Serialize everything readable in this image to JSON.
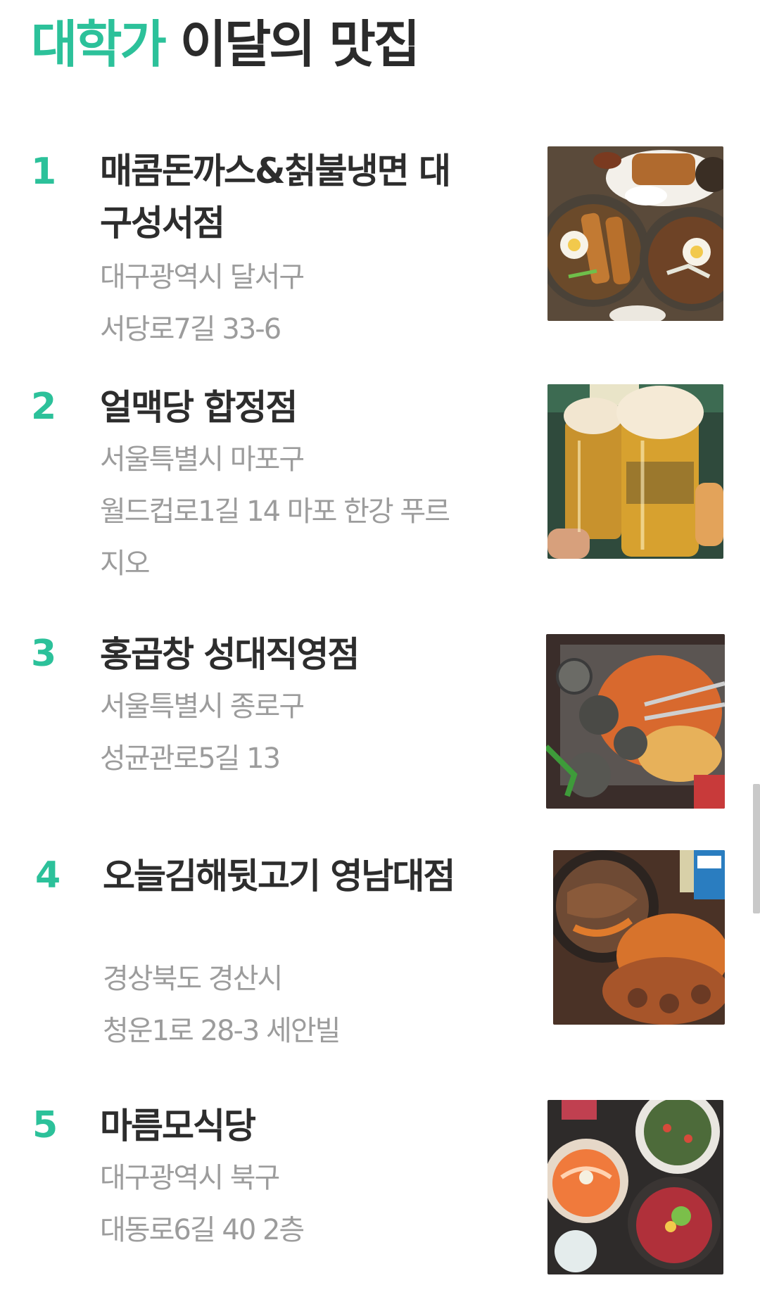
{
  "header": {
    "title_accent": "대학가",
    "title_rest": " 이달의 맛집",
    "accent_color": "#2cc19a"
  },
  "restaurants": [
    {
      "rank": "1",
      "name": "매콤돈까스&칡불냉면 대구성서점",
      "address_line1": "대구광역시 달서구",
      "address_line2": "서당로7길 33-6",
      "photo": "donkatsu-naengmyeon-photo"
    },
    {
      "rank": "2",
      "name": "얼맥당 합정점",
      "address_line1": "서울특별시 마포구",
      "address_line2": "월드컵로1길 14 마포 한강 푸르지오",
      "photo": "beer-mugs-photo"
    },
    {
      "rank": "3",
      "name": "홍곱창 성대직영점",
      "address_line1": "서울특별시 종로구",
      "address_line2": "성균관로5길 13",
      "photo": "gopchang-grill-photo"
    },
    {
      "rank": "4",
      "name": "오늘김해뒷고기 영남대점",
      "address_line1": "경상북도 경산시",
      "address_line2": "청운1로 28-3 세안빌",
      "photo": "pork-grill-photo"
    },
    {
      "rank": "5",
      "name": "마름모식당",
      "address_line1": "대구광역시 북구",
      "address_line2": "대동로6길 40 2층",
      "photo": "salmon-bowl-photo"
    }
  ]
}
